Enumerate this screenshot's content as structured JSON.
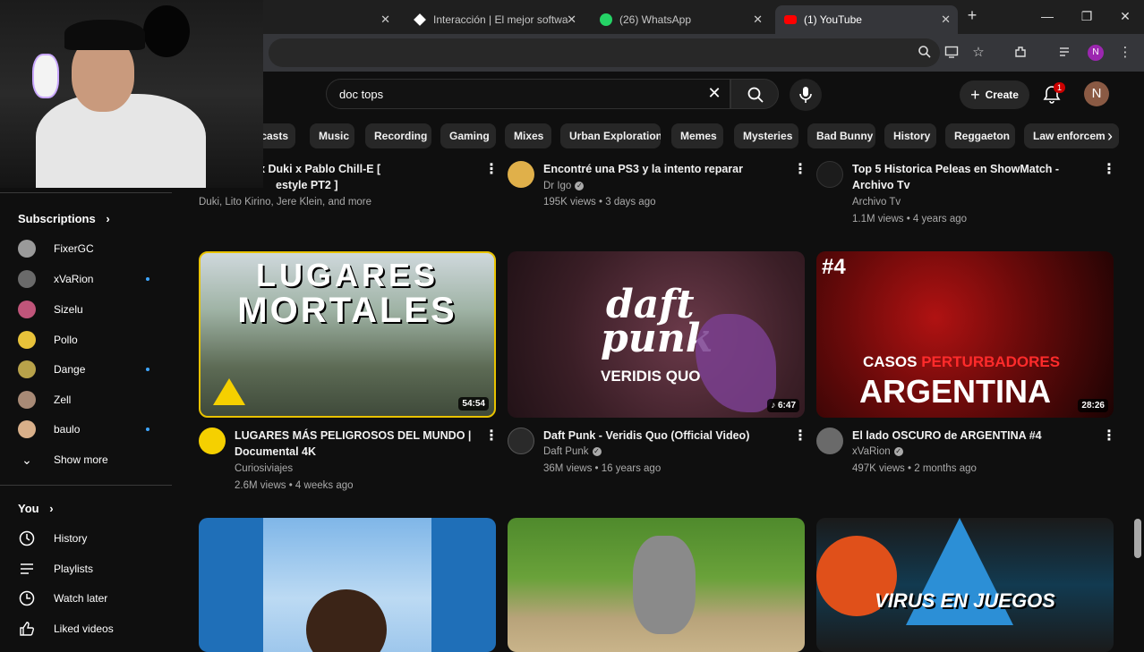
{
  "browser": {
    "tabs": [
      {
        "title": "",
        "active": false
      },
      {
        "title": "Interacción | El mejor softwa",
        "active": false
      },
      {
        "title": "(26) WhatsApp",
        "active": false
      },
      {
        "title": "(1) YouTube",
        "active": true
      }
    ],
    "new_tab_label": "+",
    "profile_initial": "N"
  },
  "header": {
    "search_value": "doc tops",
    "create_label": "Create",
    "notification_count": "1",
    "avatar_initial": "N"
  },
  "chips": [
    "dcasts",
    "Music",
    "Recording",
    "Gaming",
    "Mixes",
    "Urban Exploration",
    "Memes",
    "Mysteries",
    "Bad Bunny",
    "History",
    "Reggaeton",
    "Law enforcem"
  ],
  "sidebar": {
    "subscriptions_label": "Subscriptions",
    "subscriptions": [
      {
        "name": "FixerGC",
        "new": false,
        "color": "#9a9a9a"
      },
      {
        "name": "xVaRion",
        "new": true,
        "color": "#6a6a6a"
      },
      {
        "name": "Sizelu",
        "new": false,
        "color": "#c0557a"
      },
      {
        "name": "Pollo",
        "new": false,
        "color": "#e8c23a"
      },
      {
        "name": "Dange",
        "new": true,
        "color": "#b8a24a"
      },
      {
        "name": "Zell",
        "new": false,
        "color": "#a88a76"
      },
      {
        "name": "baulo",
        "new": true,
        "color": "#d9b08a"
      }
    ],
    "show_more_label": "Show more",
    "you_label": "You",
    "you_items": [
      {
        "label": "History",
        "icon": "history-icon"
      },
      {
        "label": "Playlists",
        "icon": "playlists-icon"
      },
      {
        "label": "Watch later",
        "icon": "watch-later-icon"
      },
      {
        "label": "Liked videos",
        "icon": "liked-videos-icon"
      }
    ]
  },
  "videos_row1": [
    {
      "title": "rino x Duki x Pablo Chill-E [",
      "title2": "estyle PT2 ]",
      "channel": "Duki, Lito Kirino, Jere Klein, and more",
      "meta": "",
      "verified": false
    },
    {
      "title": "Encontré una PS3 y la intento reparar",
      "title2": "",
      "channel": "Dr Igo",
      "meta": "195K views • 3 days ago",
      "verified": true
    },
    {
      "title": "Top 5 Historica Peleas en ShowMatch -",
      "title2": "Archivo Tv",
      "channel": "Archivo Tv",
      "meta": "1.1M views • 4 years ago",
      "verified": false
    }
  ],
  "videos_row2": [
    {
      "title": "LUGARES MÁS PELIGROSOS DEL MUNDO |",
      "title2": "Documental 4K",
      "channel": "Curiosiviajes",
      "meta": "2.6M views • 4 weeks ago",
      "duration": "54:54",
      "thumb_text1": "LUGARES",
      "thumb_text2": "MORTALES",
      "verified": false
    },
    {
      "title": "Daft Punk - Veridis Quo (Official Video)",
      "title2": "",
      "channel": "Daft Punk",
      "meta": "36M views • 16 years ago",
      "duration": "6:47",
      "thumb_text1": "daft",
      "thumb_text2": "punk",
      "thumb_text3": "VERIDIS QUO",
      "verified": true
    },
    {
      "title": "El lado OSCURO de ARGENTINA #4",
      "title2": "",
      "channel": "xVaRion",
      "meta": "497K views • 2 months ago",
      "duration": "28:26",
      "thumb_text1": "#4",
      "thumb_text2": "CASOS",
      "thumb_text3": "PERTURBADORES",
      "thumb_text4": "ARGENTINA",
      "verified": true
    }
  ],
  "videos_row3": [
    {
      "thumb_text1": "VIRUS EN JUEGOS"
    }
  ],
  "colors": {
    "bg": "#0f0f0f",
    "chip": "#272727",
    "accent_red": "#cc0000",
    "link_blue": "#3ea6ff"
  }
}
